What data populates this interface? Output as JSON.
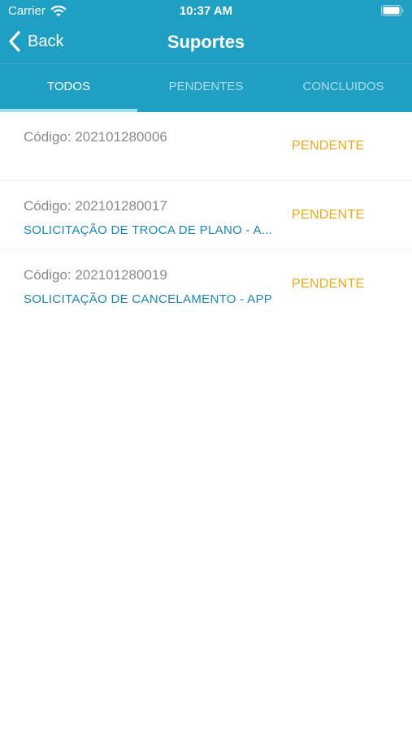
{
  "status_bar": {
    "carrier": "Carrier",
    "time": "10:37 AM"
  },
  "nav": {
    "back_label": "Back",
    "title": "Suportes"
  },
  "tabs": [
    {
      "label": "TODOS",
      "active": true
    },
    {
      "label": "PENDENTES",
      "active": false
    },
    {
      "label": "CONCLUIDOS",
      "active": false
    }
  ],
  "tickets": [
    {
      "code": "Código: 202101280006",
      "subject": "",
      "status": "PENDENTE"
    },
    {
      "code": "Código: 202101280017",
      "subject": "SOLICITAÇÃO DE TROCA DE PLANO - A...",
      "status": "PENDENTE"
    },
    {
      "code": "Código: 202101280019",
      "subject": "SOLICITAÇÃO DE CANCELAMENTO - APP",
      "status": "PENDENTE"
    }
  ],
  "colors": {
    "header": "#1f9fc4",
    "tab_indicator": "#9fe0f2",
    "status_pending": "#f0a817",
    "subject": "#1a86b8",
    "code": "#8a8a8a"
  },
  "icons": [
    "wifi-icon",
    "battery-icon",
    "back-chevron-icon"
  ]
}
